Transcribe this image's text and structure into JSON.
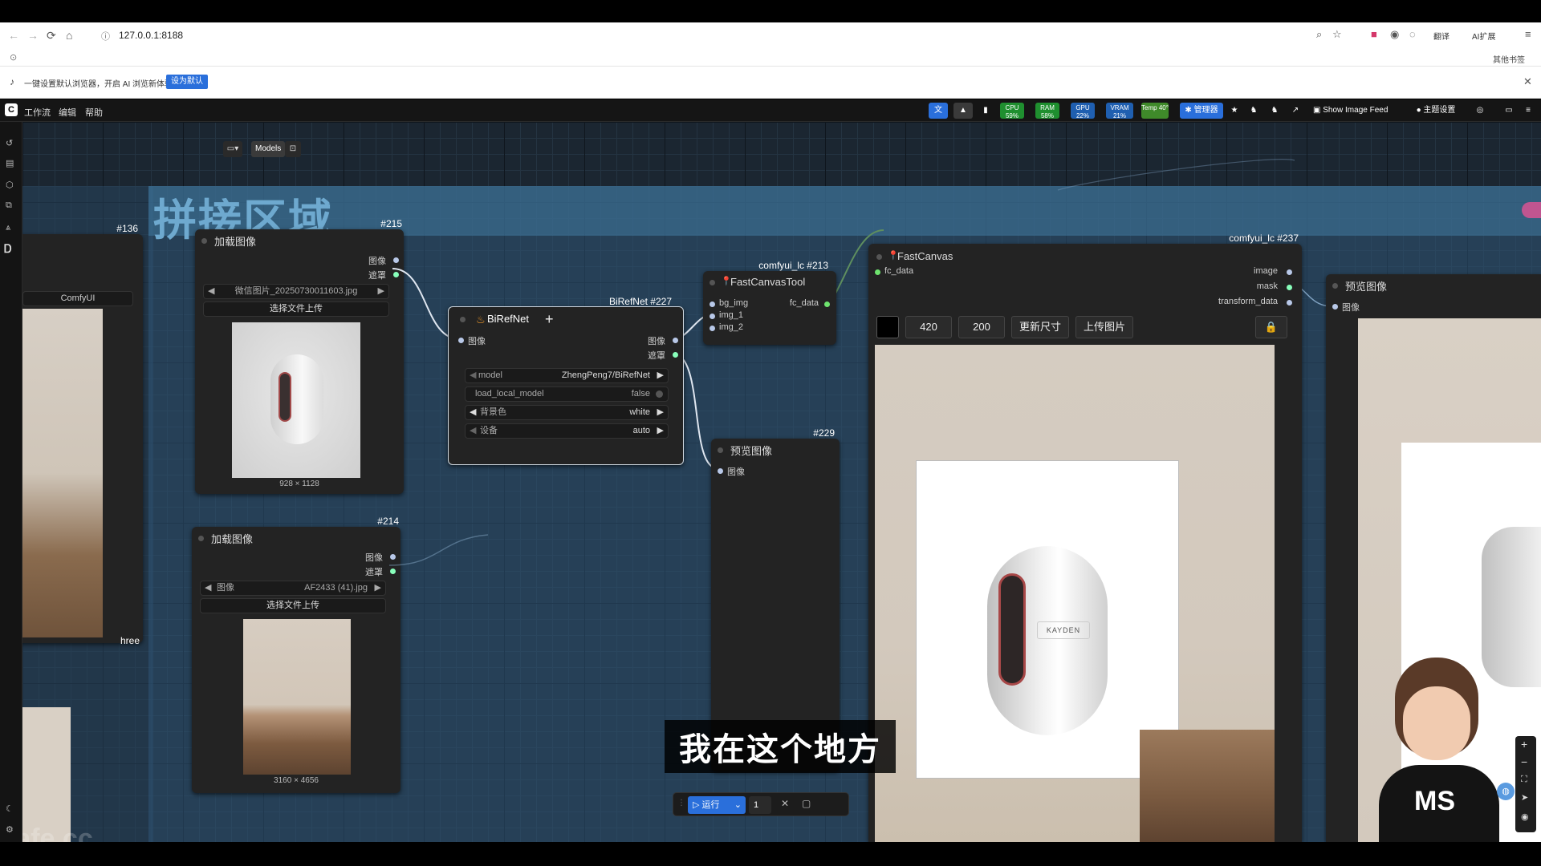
{
  "browser": {
    "url": "127.0.0.1:8188",
    "right_a": "翻译",
    "right_b": "AI扩展",
    "bookmarks": "其他书签"
  },
  "notice": {
    "text": "一键设置默认浏览器，开启 AI 浏览新体验",
    "button": "设为默认"
  },
  "menu": {
    "items": [
      "工作流",
      "编辑",
      "帮助"
    ]
  },
  "toolbar": {
    "cpu": "59%",
    "cpu_label": "CPU",
    "ram": "58%",
    "ram_label": "RAM",
    "gpu": "22%",
    "gpu_label": "GPU",
    "vram": "21%",
    "vram_label": "VRAM",
    "temp": "40°",
    "temp_label": "Temp",
    "manager": "管理器",
    "show_feed": "Show Image Feed",
    "theme": "主题设置"
  },
  "canvas_toolbar": {
    "models": "Models"
  },
  "group": {
    "title": "拼接区域"
  },
  "nodes": {
    "n136": {
      "badge": "#136",
      "label": "ComfyUI",
      "side": "hree"
    },
    "n215": {
      "badge": "#215",
      "title": "加载图像",
      "out1": "图像",
      "out2": "遮罩",
      "file": "微信图片_20250730011603.jpg",
      "upload": "选择文件上传",
      "size": "928 × 1128"
    },
    "n214": {
      "badge": "#214",
      "title": "加载图像",
      "out1": "图像",
      "out2": "遮罩",
      "file_label": "图像",
      "file": "AF2433 (41).jpg",
      "upload": "选择文件上传",
      "size": "3160 × 4656"
    },
    "n227": {
      "badge": "BiRefNet #227",
      "title": "BiRefNet",
      "in1": "图像",
      "out1": "图像",
      "out2": "遮罩",
      "w_model_k": "model",
      "w_model_v": "ZhengPeng7/BiRefNet",
      "w_local_k": "load_local_model",
      "w_local_v": "false",
      "w_bg_k": "背景色",
      "w_bg_v": "white",
      "w_dev_k": "设备",
      "w_dev_v": "auto"
    },
    "n213": {
      "badge": "comfyui_lc #213",
      "title": "FastCanvasTool",
      "in1": "bg_img",
      "in2": "img_1",
      "in3": "img_2",
      "out1": "fc_data"
    },
    "n229": {
      "badge": "#229",
      "title": "预览图像",
      "in1": "图像"
    },
    "n237": {
      "badge": "comfyui_lc #237",
      "title": "FastCanvas",
      "in1": "fc_data",
      "out1": "image",
      "out2": "mask",
      "out3": "transform_data",
      "w": "420",
      "h": "200",
      "btn_resize": "更新尺寸",
      "btn_upload": "上传图片"
    },
    "preview_right": {
      "title": "预览图像",
      "in1": "图像"
    }
  },
  "product_text": "KAYDEN",
  "subtitle": "我在这个地方",
  "run": {
    "label": "运行",
    "count": "1"
  },
  "watermark": "tafe.cc",
  "avatar_text": "MS",
  "colors": {
    "group": "#3c7396",
    "run": "#2a6fdb",
    "node": "#232323"
  }
}
